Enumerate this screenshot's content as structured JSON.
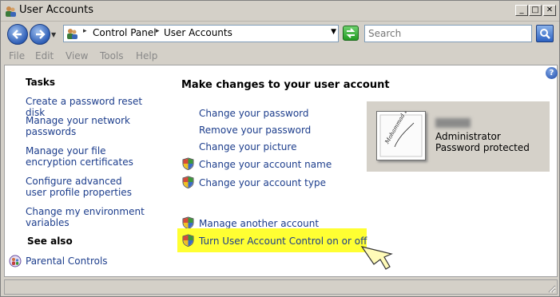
{
  "window": {
    "title": "User Accounts"
  },
  "addressbar": {
    "crumbs": [
      "Control Panel",
      "User Accounts"
    ],
    "search_placeholder": "Search"
  },
  "menubar": {
    "items": [
      "File",
      "Edit",
      "View",
      "Tools",
      "Help"
    ]
  },
  "sidebar": {
    "tasks_heading": "Tasks",
    "tasks": [
      "Create a password reset disk",
      "Manage your network passwords",
      "Manage your file encryption certificates",
      "Configure advanced user profile properties",
      "Change my environment variables"
    ],
    "see_also_heading": "See also",
    "see_also": [
      "Parental Controls"
    ]
  },
  "main": {
    "heading": "Make changes to your user account",
    "tasks": [
      "Change your password",
      "Remove your password",
      "Change your picture",
      "Change your account name",
      "Change your account type"
    ],
    "other_tasks": [
      "Manage another account",
      "Turn User Account Control on or off"
    ]
  },
  "account": {
    "role": "Administrator",
    "status": "Password protected",
    "picture_signature": "Mohammad Elshamy"
  },
  "colors": {
    "link": "#1c3d8c",
    "highlight": "#ffff32",
    "account_panel": "#d5d1c9"
  }
}
